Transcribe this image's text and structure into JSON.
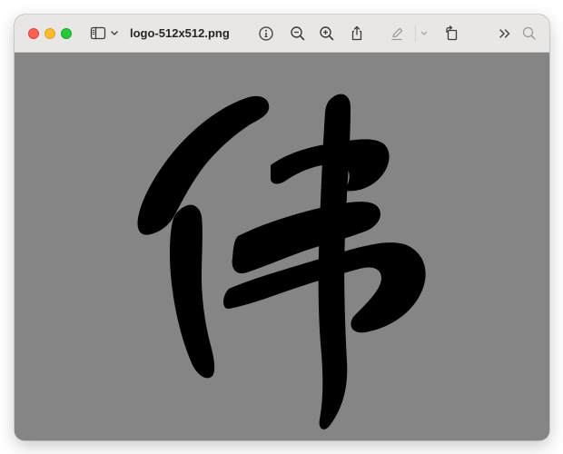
{
  "window": {
    "title": "logo-512x512.png"
  },
  "toolbar": {
    "icons": [
      "sidebar-icon",
      "chevron-down-icon",
      "info-icon",
      "zoom-out-icon",
      "zoom-in-icon",
      "share-icon",
      "markup-pen-icon",
      "chevron-down-icon",
      "rotate-icon",
      "more-chevrons-icon",
      "search-icon"
    ]
  },
  "colors": {
    "titlebar": "#e8e7e6",
    "canvas": "#858585",
    "glyph": "#000000",
    "close": "#fe5f57",
    "minimize": "#febc2e",
    "zoom": "#28c840"
  },
  "image": {
    "glyph_character": "伟"
  }
}
